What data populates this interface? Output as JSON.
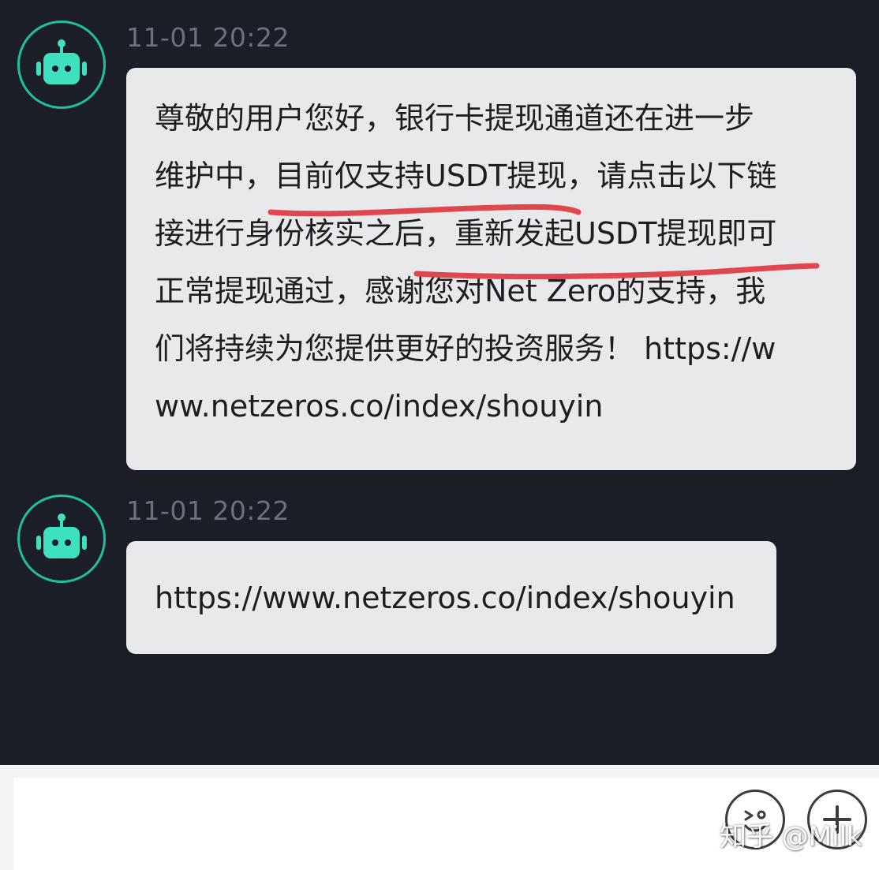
{
  "colors": {
    "background": "#1b1e26",
    "bubble": "#e9e9ec",
    "avatar_ring": "#1fbf9c",
    "bot_icon": "#3fe0c0",
    "timestamp": "#6c707a",
    "underline": "#e0474c",
    "input_area": "#ffffff"
  },
  "messages": [
    {
      "timestamp": "11-01 20:22",
      "avatar_icon": "robot-icon",
      "lines": [
        "尊敬的用户您好，银行卡提现通道还在进一步",
        "维护中，目前仅支持USDT提现，请点击以下链",
        "接进行身份核实之后，重新发起USDT提现即可",
        "正常提现通过，感谢您对Net Zero的支持，我",
        "们将持续为您提供更好的投资服务！ https://w",
        "ww.netzeros.co/index/shouyin"
      ]
    },
    {
      "timestamp": "11-01 20:22",
      "avatar_icon": "robot-icon",
      "text": "https://www.netzeros.co/index/shouyin"
    }
  ],
  "input": {
    "value": "",
    "placeholder": ""
  },
  "toolbar": {
    "emoji_icon": "emoji-icon",
    "plus_icon": "plus-icon"
  },
  "watermark": {
    "text": "知乎 @Milk"
  }
}
